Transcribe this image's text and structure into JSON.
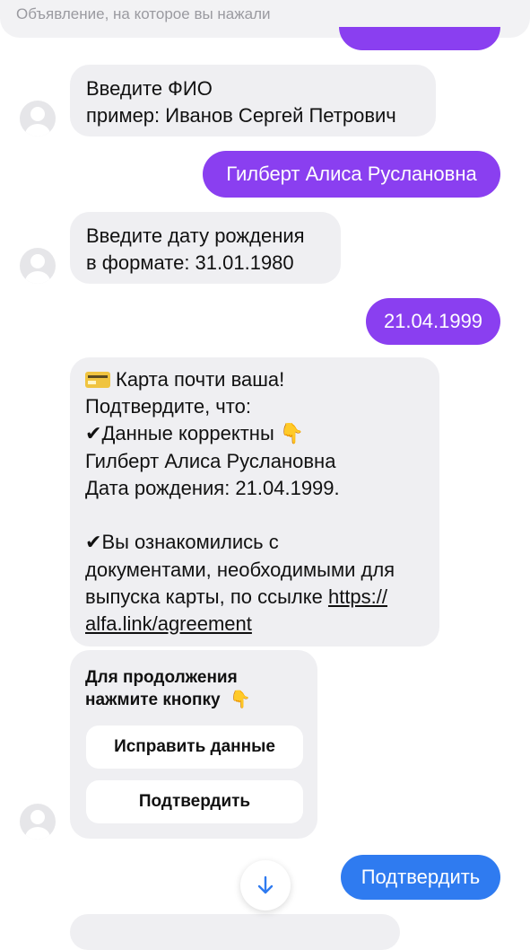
{
  "top_bar": {
    "text": "Объявление, на которое вы нажали"
  },
  "messages": [
    {
      "lines": [
        "Введите ФИО",
        "пример: Иванов Сергей Петрович"
      ]
    },
    {
      "text": "Гилберт Алиса Руслановна"
    },
    {
      "lines": [
        "Введите дату рождения",
        "в формате: 31.01.1980"
      ]
    },
    {
      "text": "21.04.1999"
    },
    {
      "line1": "Карта почти ваша!",
      "line2": "Подтвердите, что:",
      "line3": "Данные корректны",
      "line4": "Гилберт Алиса Руслановна",
      "line5": "Дата рождения: 21.04.1999.",
      "line6": "Вы ознакомились с",
      "line7": "документами, необходимыми для",
      "line8": "выпуска карты, по ссылке ",
      "link1": "https://",
      "link2": "alfa.link/agreement",
      "check": "✔",
      "point_down": "👇"
    },
    {
      "title1": "Для продолжения",
      "title2": "нажмите кнопку",
      "point_down": "👇",
      "buttons": [
        "Исправить данные",
        "Подтвердить"
      ]
    },
    {
      "text": "Подтвердить"
    }
  ],
  "colors": {
    "purple": "#8a3ff0",
    "blue": "#2f7bf0",
    "incoming": "#efeff2"
  },
  "icons": {
    "avatar": "user-avatar-icon",
    "scroll": "arrow-down-icon",
    "card": "credit-card-icon"
  }
}
